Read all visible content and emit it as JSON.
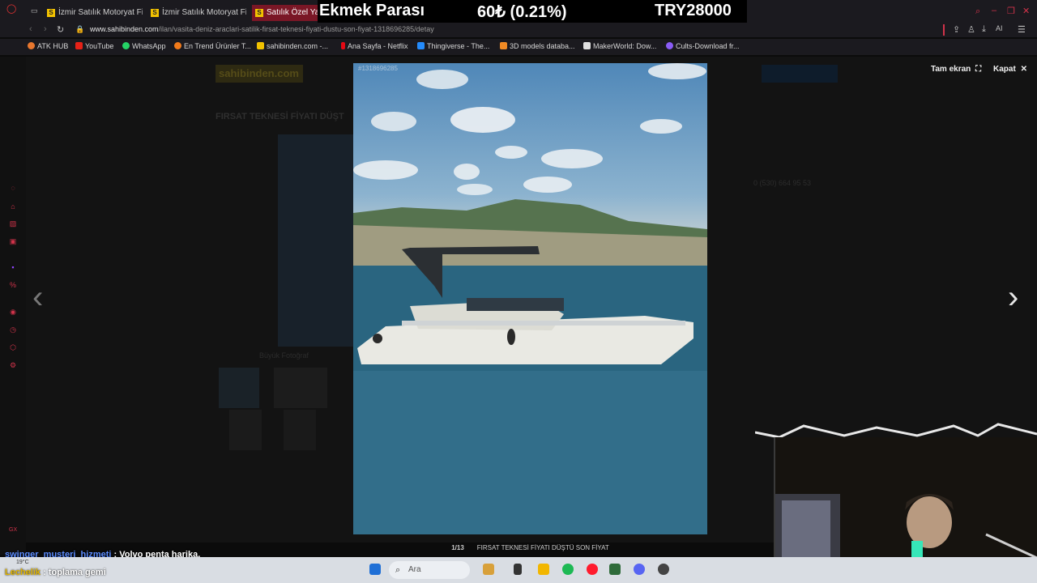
{
  "browser": {
    "tabs": [
      {
        "label": "İzmir Satılık Motoryat Fiyatl",
        "active": false
      },
      {
        "label": "İzmir Satılık Motoryat Fiyatl",
        "active": false
      },
      {
        "label": "Satılık Özel Yap",
        "active": true
      }
    ],
    "url_domain": "www.sahibinden.com",
    "url_path": "/ilan/vasita-deniz-araclari-satilik-firsat-teknesi-fiyati-dustu-son-fiyat-1318696285/detay",
    "bookmarks": [
      {
        "label": "ATK HUB",
        "color": "#e8772e"
      },
      {
        "label": "YouTube",
        "color": "#e62117"
      },
      {
        "label": "WhatsApp",
        "color": "#25d366"
      },
      {
        "label": "En Trend Ürünler T...",
        "color": "#f27a1a"
      },
      {
        "label": "sahibinden.com -...",
        "color": "#f2c200"
      },
      {
        "label": "Ana Sayfa - Netflix",
        "color": "#e50914"
      },
      {
        "label": "Thingiverse - The...",
        "color": "#248bfb"
      },
      {
        "label": "3D models databa...",
        "color": "#f08a24"
      },
      {
        "label": "MakerWorld: Dow...",
        "color": "#e0e0e0"
      },
      {
        "label": "Cults-Download fr...",
        "color": "#8a5cf6"
      }
    ]
  },
  "stream_overlay": {
    "title": "Ekmek Parası",
    "value": "60₺ (0.21%)",
    "total": "TRY28000"
  },
  "site": {
    "logo": "sahibinden.com",
    "listing_title": "FIRSAT TEKNESİ FİYATI DÜŞT",
    "phone": "0 (530) 664 95 53",
    "big_photo_label": "Büyük Fotoğraf"
  },
  "gallery": {
    "photo_id": "#1318696285",
    "fullscreen_label": "Tam ekran",
    "close_label": "Kapat",
    "counter": "1/13",
    "caption": "FIRSAT TEKNESİ FİYATI DÜŞTÜ SON FİYAT"
  },
  "chat": [
    {
      "user": "swinger_musteri_hizmeti",
      "message": ": Volvo penta harika.",
      "user_color": "#5b8cff"
    },
    {
      "user": "Lechelik",
      "message": ": toplama gemi",
      "user_color": "#e0b400"
    }
  ],
  "taskbar": {
    "search_placeholder": "Ara",
    "weather": "19°C"
  }
}
